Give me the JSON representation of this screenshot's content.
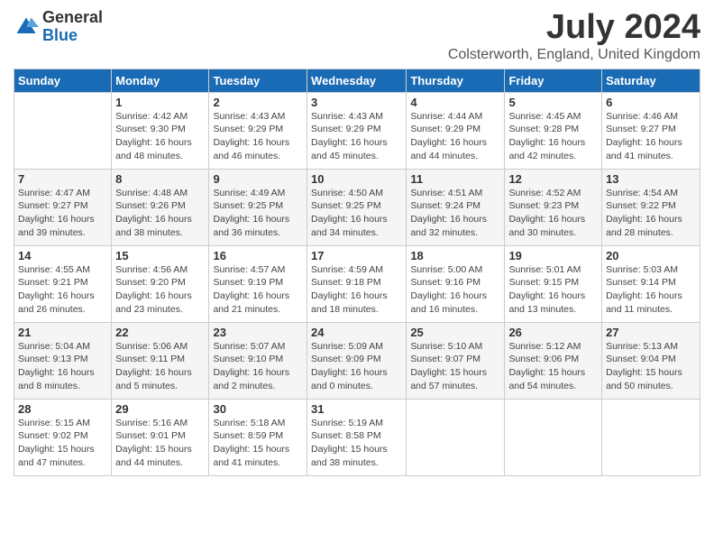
{
  "logo": {
    "general": "General",
    "blue": "Blue"
  },
  "title": "July 2024",
  "subtitle": "Colsterworth, England, United Kingdom",
  "days_header": [
    "Sunday",
    "Monday",
    "Tuesday",
    "Wednesday",
    "Thursday",
    "Friday",
    "Saturday"
  ],
  "weeks": [
    [
      {
        "day": "",
        "info": ""
      },
      {
        "day": "1",
        "info": "Sunrise: 4:42 AM\nSunset: 9:30 PM\nDaylight: 16 hours\nand 48 minutes."
      },
      {
        "day": "2",
        "info": "Sunrise: 4:43 AM\nSunset: 9:29 PM\nDaylight: 16 hours\nand 46 minutes."
      },
      {
        "day": "3",
        "info": "Sunrise: 4:43 AM\nSunset: 9:29 PM\nDaylight: 16 hours\nand 45 minutes."
      },
      {
        "day": "4",
        "info": "Sunrise: 4:44 AM\nSunset: 9:29 PM\nDaylight: 16 hours\nand 44 minutes."
      },
      {
        "day": "5",
        "info": "Sunrise: 4:45 AM\nSunset: 9:28 PM\nDaylight: 16 hours\nand 42 minutes."
      },
      {
        "day": "6",
        "info": "Sunrise: 4:46 AM\nSunset: 9:27 PM\nDaylight: 16 hours\nand 41 minutes."
      }
    ],
    [
      {
        "day": "7",
        "info": "Sunrise: 4:47 AM\nSunset: 9:27 PM\nDaylight: 16 hours\nand 39 minutes."
      },
      {
        "day": "8",
        "info": "Sunrise: 4:48 AM\nSunset: 9:26 PM\nDaylight: 16 hours\nand 38 minutes."
      },
      {
        "day": "9",
        "info": "Sunrise: 4:49 AM\nSunset: 9:25 PM\nDaylight: 16 hours\nand 36 minutes."
      },
      {
        "day": "10",
        "info": "Sunrise: 4:50 AM\nSunset: 9:25 PM\nDaylight: 16 hours\nand 34 minutes."
      },
      {
        "day": "11",
        "info": "Sunrise: 4:51 AM\nSunset: 9:24 PM\nDaylight: 16 hours\nand 32 minutes."
      },
      {
        "day": "12",
        "info": "Sunrise: 4:52 AM\nSunset: 9:23 PM\nDaylight: 16 hours\nand 30 minutes."
      },
      {
        "day": "13",
        "info": "Sunrise: 4:54 AM\nSunset: 9:22 PM\nDaylight: 16 hours\nand 28 minutes."
      }
    ],
    [
      {
        "day": "14",
        "info": "Sunrise: 4:55 AM\nSunset: 9:21 PM\nDaylight: 16 hours\nand 26 minutes."
      },
      {
        "day": "15",
        "info": "Sunrise: 4:56 AM\nSunset: 9:20 PM\nDaylight: 16 hours\nand 23 minutes."
      },
      {
        "day": "16",
        "info": "Sunrise: 4:57 AM\nSunset: 9:19 PM\nDaylight: 16 hours\nand 21 minutes."
      },
      {
        "day": "17",
        "info": "Sunrise: 4:59 AM\nSunset: 9:18 PM\nDaylight: 16 hours\nand 18 minutes."
      },
      {
        "day": "18",
        "info": "Sunrise: 5:00 AM\nSunset: 9:16 PM\nDaylight: 16 hours\nand 16 minutes."
      },
      {
        "day": "19",
        "info": "Sunrise: 5:01 AM\nSunset: 9:15 PM\nDaylight: 16 hours\nand 13 minutes."
      },
      {
        "day": "20",
        "info": "Sunrise: 5:03 AM\nSunset: 9:14 PM\nDaylight: 16 hours\nand 11 minutes."
      }
    ],
    [
      {
        "day": "21",
        "info": "Sunrise: 5:04 AM\nSunset: 9:13 PM\nDaylight: 16 hours\nand 8 minutes."
      },
      {
        "day": "22",
        "info": "Sunrise: 5:06 AM\nSunset: 9:11 PM\nDaylight: 16 hours\nand 5 minutes."
      },
      {
        "day": "23",
        "info": "Sunrise: 5:07 AM\nSunset: 9:10 PM\nDaylight: 16 hours\nand 2 minutes."
      },
      {
        "day": "24",
        "info": "Sunrise: 5:09 AM\nSunset: 9:09 PM\nDaylight: 16 hours\nand 0 minutes."
      },
      {
        "day": "25",
        "info": "Sunrise: 5:10 AM\nSunset: 9:07 PM\nDaylight: 15 hours\nand 57 minutes."
      },
      {
        "day": "26",
        "info": "Sunrise: 5:12 AM\nSunset: 9:06 PM\nDaylight: 15 hours\nand 54 minutes."
      },
      {
        "day": "27",
        "info": "Sunrise: 5:13 AM\nSunset: 9:04 PM\nDaylight: 15 hours\nand 50 minutes."
      }
    ],
    [
      {
        "day": "28",
        "info": "Sunrise: 5:15 AM\nSunset: 9:02 PM\nDaylight: 15 hours\nand 47 minutes."
      },
      {
        "day": "29",
        "info": "Sunrise: 5:16 AM\nSunset: 9:01 PM\nDaylight: 15 hours\nand 44 minutes."
      },
      {
        "day": "30",
        "info": "Sunrise: 5:18 AM\nSunset: 8:59 PM\nDaylight: 15 hours\nand 41 minutes."
      },
      {
        "day": "31",
        "info": "Sunrise: 5:19 AM\nSunset: 8:58 PM\nDaylight: 15 hours\nand 38 minutes."
      },
      {
        "day": "",
        "info": ""
      },
      {
        "day": "",
        "info": ""
      },
      {
        "day": "",
        "info": ""
      }
    ]
  ]
}
